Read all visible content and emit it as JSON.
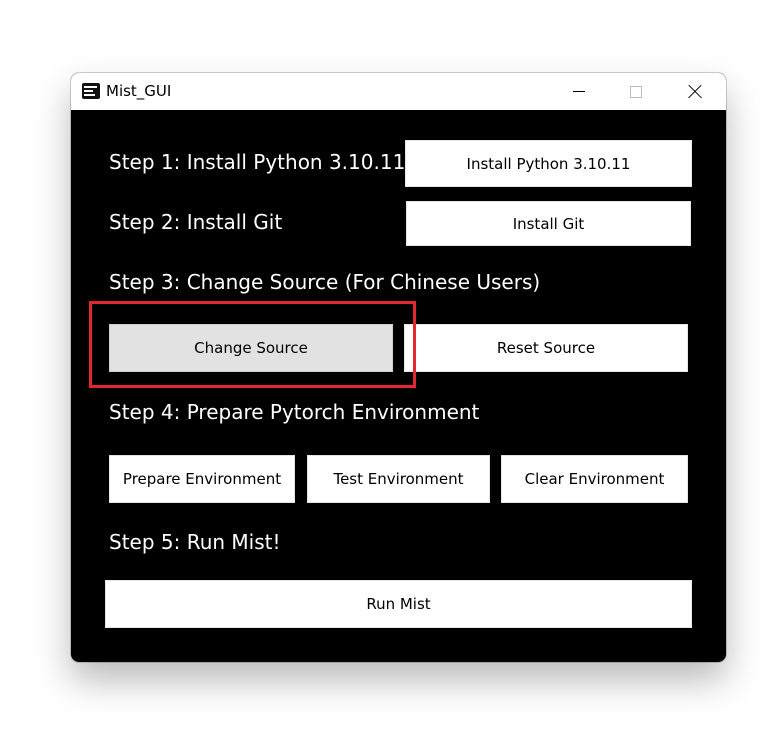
{
  "window": {
    "title": "Mist_GUI",
    "controls": {
      "minimize": "minimize",
      "maximize": "maximize",
      "close": "close"
    }
  },
  "steps": {
    "step1": {
      "label": "Step 1: Install Python 3.10.11",
      "button": "Install Python 3.10.11"
    },
    "step2": {
      "label": "Step 2: Install Git",
      "button": "Install Git"
    },
    "step3": {
      "label": "Step 3: Change Source (For Chinese Users)",
      "buttons": [
        "Change Source",
        "Reset Source"
      ]
    },
    "step4": {
      "label": "Step 4: Prepare Pytorch Environment",
      "buttons": [
        "Prepare Environment",
        "Test Environment",
        "Clear Environment"
      ]
    },
    "step5": {
      "label": "Step 5: Run Mist!",
      "button": "Run Mist"
    }
  },
  "highlight_color": "#e3262f"
}
